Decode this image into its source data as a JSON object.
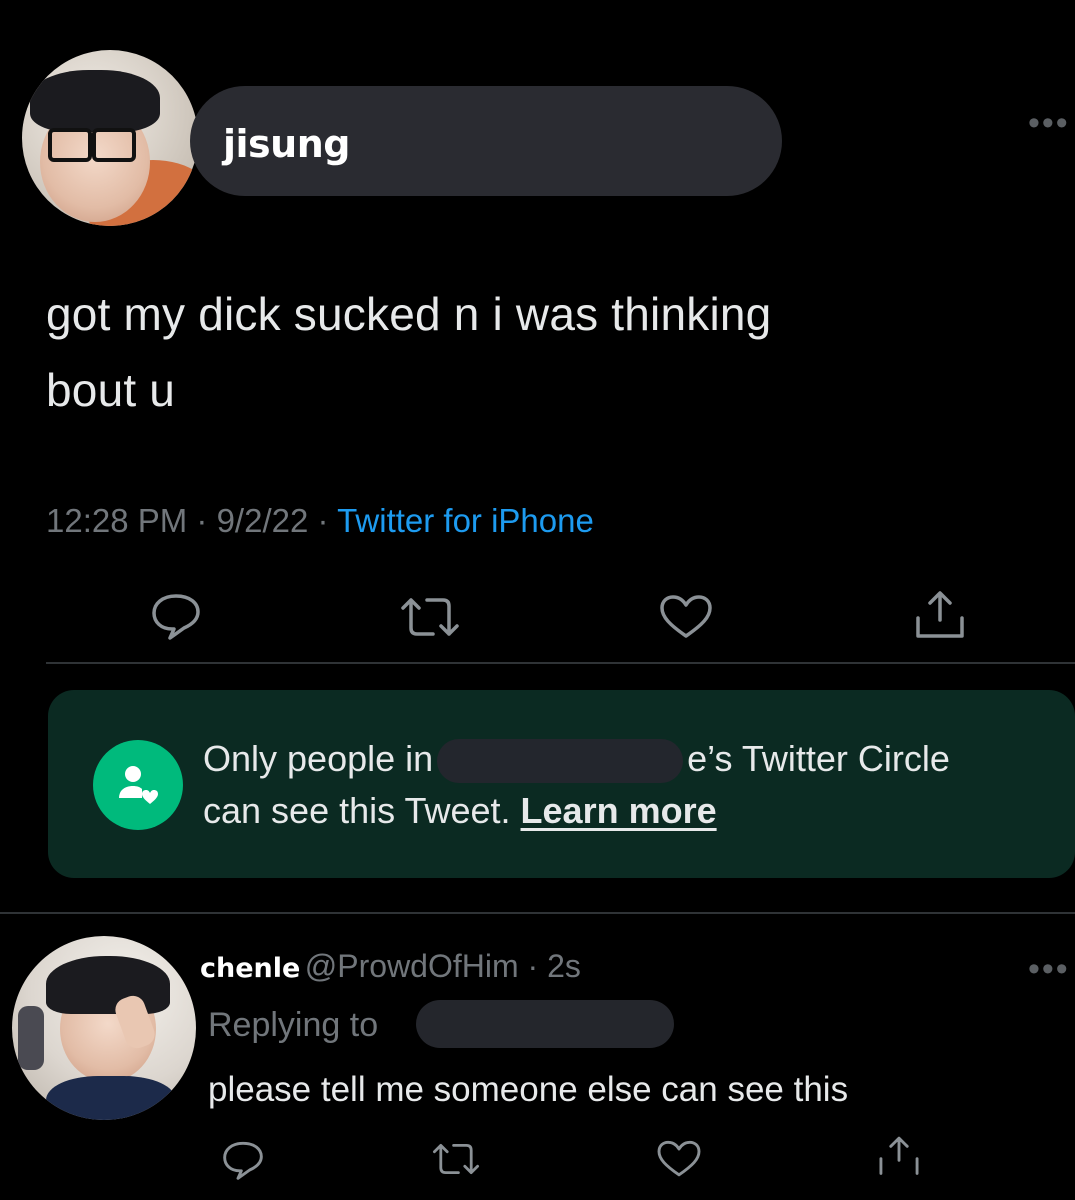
{
  "main_tweet": {
    "author_name": "jisung",
    "text_line1": "got my dick sucked n i was thinking",
    "text_line2": "bout u",
    "time": "12:28 PM",
    "sep1": " · ",
    "date": "9/2/22",
    "sep2": " · ",
    "source": "Twitter for iPhone"
  },
  "circle_notice": {
    "line1_before": "Only people in",
    "line1_after": "e’s Twitter Circle",
    "line2": "can see this Tweet.",
    "learn_more": "Learn more"
  },
  "reply": {
    "author_name": "chenle",
    "handle": "@ProwdOfHim",
    "sep": " · ",
    "time": "2s",
    "replying_to": "Replying to",
    "text": "please tell me someone else can see this"
  },
  "icons": {
    "more": "more-dots-icon",
    "reply": "reply-bubble-icon",
    "retweet": "retweet-icon",
    "like": "heart-icon",
    "share": "share-icon",
    "circle": "circle-people-icon"
  },
  "colors": {
    "background": "#000000",
    "link": "#1d9bf0",
    "circle_bg": "#0b2a22",
    "circle_icon": "#00ba7c"
  }
}
